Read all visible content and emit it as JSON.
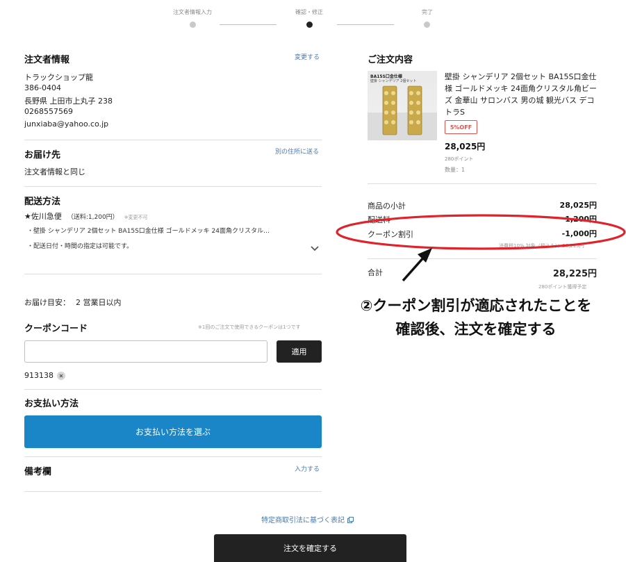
{
  "steps": [
    {
      "label": "注文者情報入力",
      "active": false
    },
    {
      "label": "確認・修正",
      "active": true
    },
    {
      "label": "完了",
      "active": false
    }
  ],
  "orderer": {
    "title": "注文者情報",
    "edit_link": "変更する",
    "name": "トラックショップ龍",
    "zip": "386-0404",
    "address": "長野県 上田市上丸子 238",
    "phone": "0268557569",
    "email": "junxiaba@yahoo.co.jp"
  },
  "delivery": {
    "title": "お届け先",
    "link": "別の住所に送る",
    "value": "注文者情報と同じ"
  },
  "shipping": {
    "title": "配送方法",
    "carrier": "★佐川急便",
    "fee": "（送料:1,200円）",
    "note": "※変更不可",
    "item_line": "・壁掛 シャンデリア 2個セット BA15S口金仕様 ゴールドメッキ 24面角クリスタル…",
    "date_note": "・配送日付・時間の指定は可能です。"
  },
  "eta": {
    "label": "お届け目安：",
    "value": "2 営業日以内"
  },
  "coupon": {
    "title": "クーポンコード",
    "note": "※1回のご注文で使用できるクーポンは1つです",
    "input_value": "",
    "apply_label": "適用",
    "applied_code": "913138",
    "remove_icon": "close-icon"
  },
  "payment": {
    "title": "お支払い方法",
    "button_label": "お支払い方法を選ぶ"
  },
  "remarks": {
    "title": "備考欄",
    "link": "入力する"
  },
  "footer": {
    "law_link": "特定商取引法に基づく表記",
    "law_icon": "external-link-icon",
    "confirm_label": "注文を確定する"
  },
  "order": {
    "title": "ご注文内容",
    "product": {
      "thumb_line1": "BA15S口金仕様",
      "thumb_line2": "壁掛 シャンデリア 2個セット",
      "name": "壁掛 シャンデリア 2個セット BA15S口金仕様 ゴールドメッキ 24面角クリスタル角ビーズ 金華山 サロンバス 男の城 観光バス デコトラS",
      "badge": "5%OFF",
      "price": "28,025円",
      "points": "280ポイント",
      "quantity": "数量：1"
    },
    "summary": {
      "subtotal_label": "商品の小計",
      "subtotal_value": "28,025円",
      "shipping_label": "配送料",
      "shipping_value": "1,200円",
      "coupon_label": "クーポン割引",
      "coupon_value": "-1,000円",
      "tax_note": "消費税10% 対象（税込み）：28,225円",
      "total_label": "合計",
      "total_value": "28,225円",
      "points_note": "280ポイント獲得予定"
    }
  },
  "annotation": {
    "line1": "②クーポン割引が適応されたことを",
    "line2": "確認後、注文を確定する",
    "color": "#e0222a"
  }
}
